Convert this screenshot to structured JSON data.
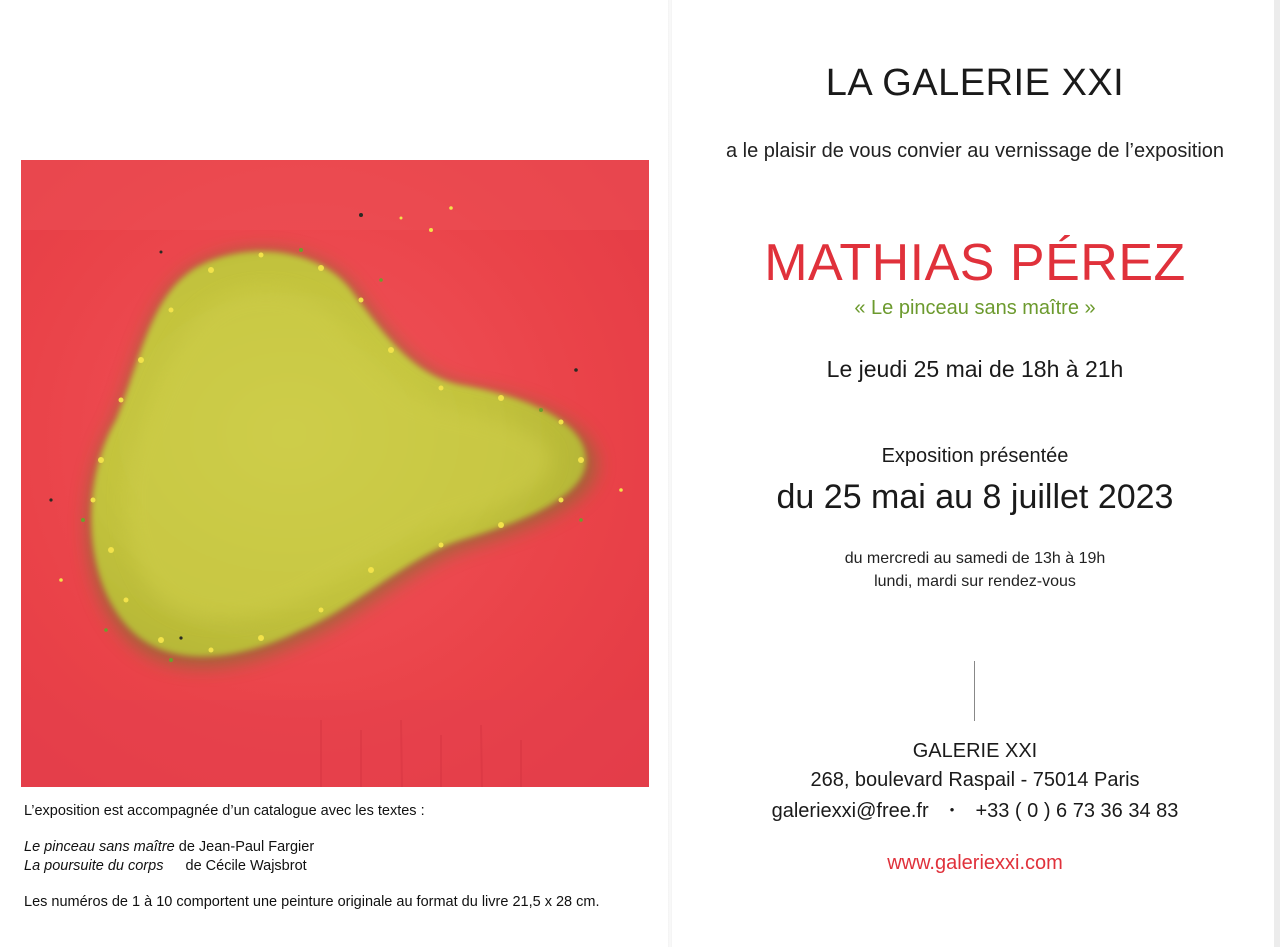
{
  "header": {
    "gallery_name": "LA GALERIE XXI",
    "invitation": "a le plaisir de vous convier au vernissage de l’exposition"
  },
  "exhibition": {
    "artist": "MATHIAS PÉREZ",
    "title": "« Le pinceau sans maître »",
    "opening": "Le jeudi 25 mai de 18h à 21h",
    "presented_label": "Exposition présentée",
    "dates": "du 25 mai au 8 juillet 2023",
    "hours_line1": "du mercredi au samedi de 13h à 19h",
    "hours_line2": "lundi, mardi sur rendez-vous"
  },
  "contact": {
    "name": "GALERIE XXI",
    "address": "268, boulevard Raspail - 75014 Paris",
    "email": "galeriexxi@free.fr",
    "separator": "•",
    "phone": "+33 ( 0 ) 6 73 36 34 83",
    "website": "www.galeriexxi.com"
  },
  "catalog": {
    "intro": "L’exposition est accompagnée d’un catalogue avec les textes :",
    "text1_title": "Le pinceau sans maître",
    "text1_author": "de Jean-Paul Fargier",
    "text2_title": "La poursuite du corps",
    "text2_author": "de Cécile Wajsbrot",
    "note": "Les numéros de 1 à 10 comportent une peinture originale au format du livre 21,5 x 28 cm."
  },
  "colors": {
    "accent_red": "#e0313b",
    "subtitle_green": "#6c9a2e",
    "painting_red": "#e8444a",
    "painting_yellow": "#c9c63a"
  }
}
